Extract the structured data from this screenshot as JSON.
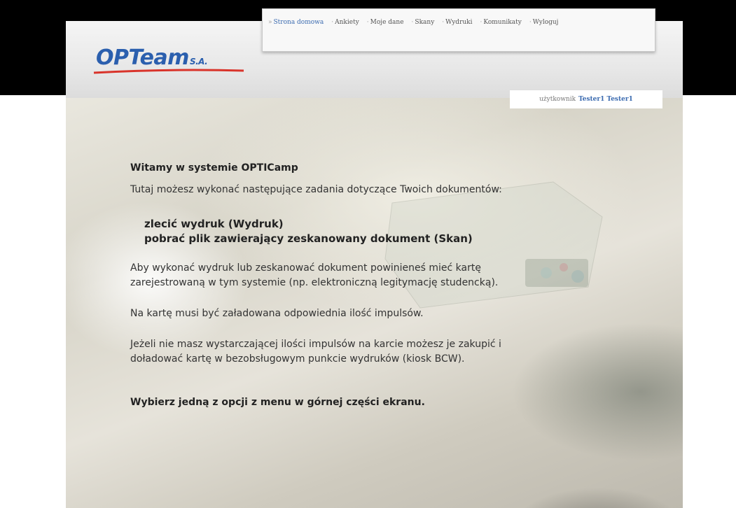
{
  "nav": {
    "items": [
      {
        "label": "Strona domowa",
        "active": true
      },
      {
        "label": "Ankiety",
        "active": false
      },
      {
        "label": "Moje dane",
        "active": false
      },
      {
        "label": "Skany",
        "active": false
      },
      {
        "label": "Wydruki",
        "active": false
      },
      {
        "label": "Komunikaty",
        "active": false
      },
      {
        "label": "Wyloguj",
        "active": false
      }
    ]
  },
  "logo": {
    "name": "OPTeam",
    "suffix": "S.A."
  },
  "user": {
    "label": "użytkownik",
    "name": "Tester1 Tester1"
  },
  "content": {
    "title": "Witamy w systemie OPTICamp",
    "intro": "Tutaj możesz wykonać następujące zadania dotyczące Twoich dokumentów:",
    "options": [
      "zlecić wydruk (Wydruk)",
      "pobrać plik zawierający zeskanowany dokument (Skan)"
    ],
    "paragraph1_line1": "Aby wykonać wydruk lub zeskanować dokument powinieneś mieć kartę",
    "paragraph1_line2": "zarejestrowaną w tym systemie (np. elektroniczną legitymację studencką).",
    "paragraph2": "Na kartę musi być załadowana odpowiednia ilość impulsów.",
    "paragraph3_line1": "Jeżeli nie masz wystarczającej ilości impulsów na karcie możesz je zakupić i",
    "paragraph3_line2": "doładować kartę w bezobsługowym punkcie wydruków (kiosk BCW).",
    "closing": "Wybierz jedną z opcji z menu w górnej części ekranu."
  },
  "colors": {
    "brand": "#2b5fae",
    "accent_red": "#d9342b",
    "nav_active": "#3b6bb0"
  }
}
